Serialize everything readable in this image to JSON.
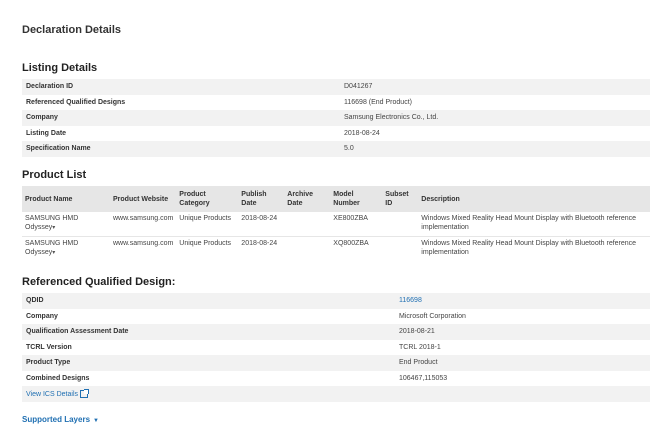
{
  "page_title": "Declaration Details",
  "listing": {
    "title": "Listing Details",
    "rows": [
      {
        "label": "Declaration ID",
        "value": "D041267"
      },
      {
        "label": "Referenced Qualified Designs",
        "value": "116698 (End Product)"
      },
      {
        "label": "Company",
        "value": "Samsung Electronics Co., Ltd."
      },
      {
        "label": "Listing Date",
        "value": "2018-08-24"
      },
      {
        "label": "Specification Name",
        "value": "5.0"
      }
    ]
  },
  "product_list": {
    "title": "Product List",
    "headers": {
      "name": "Product Name",
      "website": "Product Website",
      "category": "Product Category",
      "publish": "Publish Date",
      "archive": "Archive Date",
      "model": "Model Number",
      "subset": "Subset ID",
      "description": "Description"
    },
    "rows": [
      {
        "name": "SAMSUNG HMD Odyssey",
        "website": "www.samsung.com",
        "category": "Unique Products",
        "publish": "2018-08-24",
        "archive": "",
        "model": "XE800ZBA",
        "subset": "",
        "description": "Windows Mixed Reality Head Mount Display with Bluetooth reference implementation"
      },
      {
        "name": "SAMSUNG HMD Odyssey",
        "website": "www.samsung.com",
        "category": "Unique Products",
        "publish": "2018-08-24",
        "archive": "",
        "model": "XQ800ZBA",
        "subset": "",
        "description": "Windows Mixed Reality Head Mount Display with Bluetooth reference implementation"
      }
    ]
  },
  "rqd": {
    "title": "Referenced Qualified Design:",
    "rows": [
      {
        "label": "QDID",
        "value": "116698"
      },
      {
        "label": "Company",
        "value": "Microsoft Corporation"
      },
      {
        "label": "Qualification Assessment Date",
        "value": "2018-08-21"
      },
      {
        "label": "TCRL Version",
        "value": "TCRL 2018-1"
      },
      {
        "label": "Product Type",
        "value": "End Product"
      },
      {
        "label": "Combined Designs",
        "value": "106467,115053"
      }
    ],
    "ics_link": "View ICS Details"
  },
  "supported_layers": "Supported Layers",
  "colors": {
    "link": "#1f6fb2",
    "row_shade": "#f2f2f2",
    "header_bg": "#e6e6e6"
  }
}
